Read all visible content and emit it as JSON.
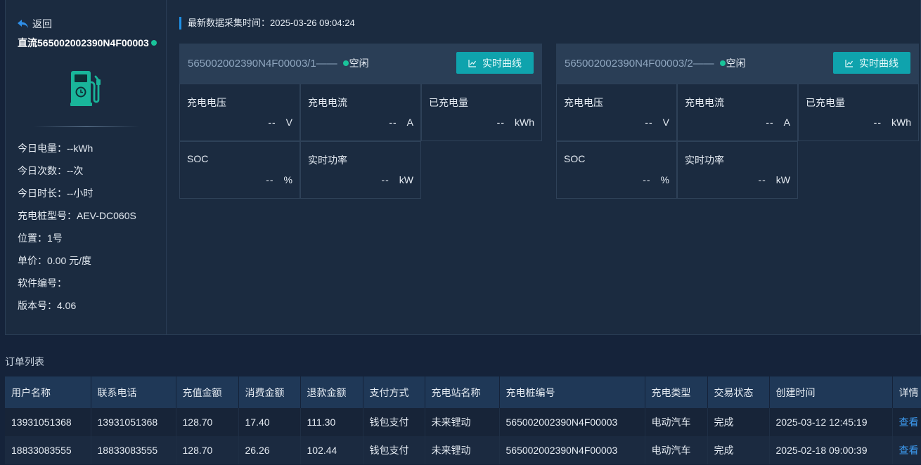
{
  "back_label": "返回",
  "device": {
    "title": "直流565002002390N4F00003",
    "status_color": "#19c39a",
    "icon": "charging-station-icon"
  },
  "info": [
    {
      "label": "今日电量：",
      "value": "--kWh"
    },
    {
      "label": "今日次数：",
      "value": "--次"
    },
    {
      "label": "今日时长：",
      "value": "--小时"
    },
    {
      "label": "充电桩型号：",
      "value": "AEV-DC060S"
    },
    {
      "label": "位置：",
      "value": "1号"
    },
    {
      "label": "单价：",
      "value": "0.00 元/度"
    },
    {
      "label": "软件编号：",
      "value": ""
    },
    {
      "label": "版本号：",
      "value": "4.06"
    }
  ],
  "collect_time": "最新数据采集时间：2025-03-26 09:04:24",
  "guns": [
    {
      "name": "565002002390N4F00003/1——",
      "status": "空闲",
      "button": "实时曲线",
      "metrics": [
        {
          "label": "充电电压",
          "value": "--",
          "unit": "V"
        },
        {
          "label": "充电电流",
          "value": "--",
          "unit": "A"
        },
        {
          "label": "已充电量",
          "value": "--",
          "unit": "kWh"
        },
        {
          "label": "SOC",
          "value": "--",
          "unit": "%"
        },
        {
          "label": "实时功率",
          "value": "--",
          "unit": "kW"
        }
      ]
    },
    {
      "name": "565002002390N4F00003/2——",
      "status": "空闲",
      "button": "实时曲线",
      "metrics": [
        {
          "label": "充电电压",
          "value": "--",
          "unit": "V"
        },
        {
          "label": "充电电流",
          "value": "--",
          "unit": "A"
        },
        {
          "label": "已充电量",
          "value": "--",
          "unit": "kWh"
        },
        {
          "label": "SOC",
          "value": "--",
          "unit": "%"
        },
        {
          "label": "实时功率",
          "value": "--",
          "unit": "kW"
        }
      ]
    }
  ],
  "orders": {
    "title": "订单列表",
    "columns": [
      "用户名称",
      "联系电话",
      "充值金额",
      "消费金额",
      "退款金额",
      "支付方式",
      "充电站名称",
      "充电桩编号",
      "充电类型",
      "交易状态",
      "创建时间",
      "详情"
    ],
    "rows": [
      [
        "13931051368",
        "13931051368",
        "128.70",
        "17.40",
        "111.30",
        "钱包支付",
        "未来锂动",
        "565002002390N4F00003",
        "电动汽车",
        "完成",
        "2025-03-12 12:45:19",
        "查看"
      ],
      [
        "18833083555",
        "18833083555",
        "128.70",
        "26.26",
        "102.44",
        "钱包支付",
        "未来锂动",
        "565002002390N4F00003",
        "电动汽车",
        "完成",
        "2025-02-18 09:00:39",
        "查看"
      ]
    ]
  }
}
